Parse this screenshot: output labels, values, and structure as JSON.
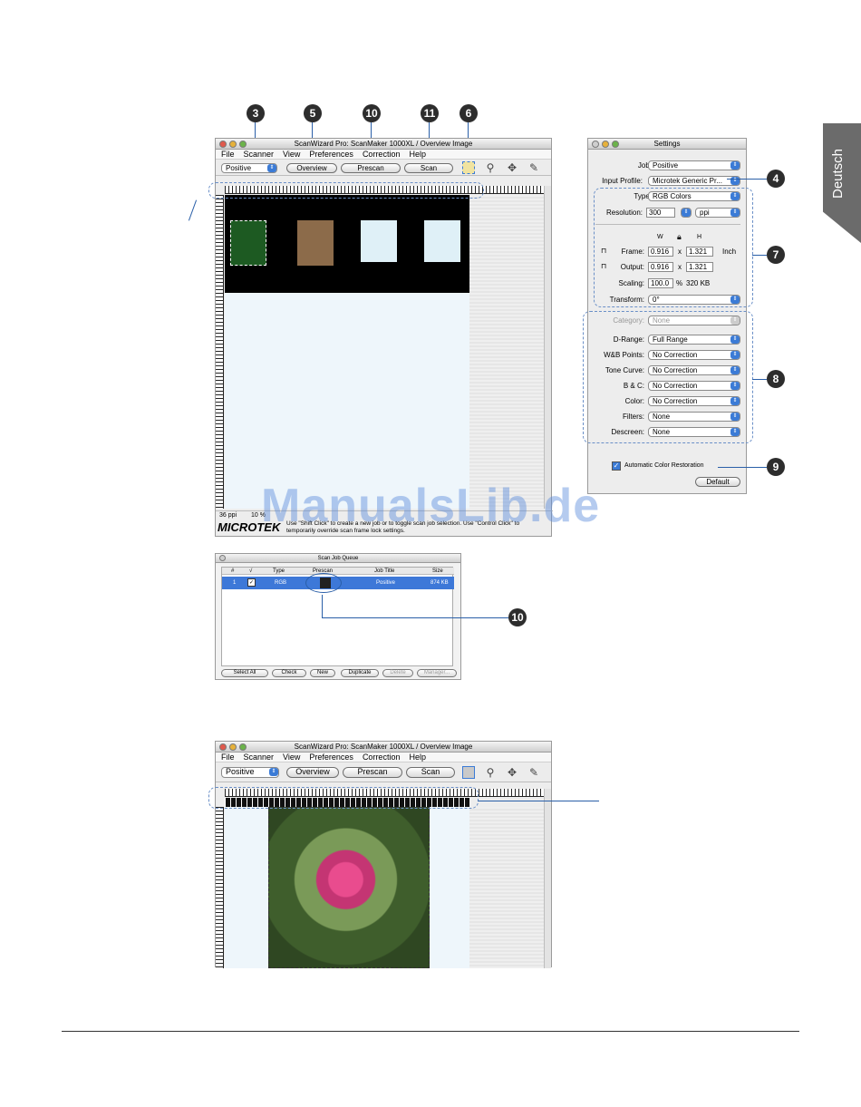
{
  "side_tab": "Deutsch",
  "callouts": [
    "3",
    "5",
    "10",
    "11",
    "6",
    "4",
    "7",
    "8",
    "9",
    "10"
  ],
  "main_window": {
    "title": "ScanWizard Pro: ScanMaker 1000XL / Overview Image",
    "menu": [
      "File",
      "Scanner",
      "View",
      "Preferences",
      "Correction",
      "Help"
    ],
    "job_popup": "Positive",
    "buttons": {
      "overview": "Overview",
      "prescan": "Prescan",
      "scan": "Scan"
    },
    "status_ppi": "36 ppi",
    "status_zoom": "10 %",
    "brand": "MICROTEK",
    "hint": "Use \"Shift Click\" to create a new job or to toggle scan job selection. Use \"Control Click\" to temporarily override scan frame lock settings."
  },
  "settings": {
    "title": "Settings",
    "job_label": "Job:",
    "job_value": "Positive",
    "input_profile_label": "Input Profile:",
    "input_profile_value": "Microtek Generic Pr...",
    "type_label": "Type:",
    "type_value": "RGB Colors",
    "resolution_label": "Resolution:",
    "resolution_value": "300",
    "resolution_unit": "ppi",
    "w_label": "W",
    "h_label": "H",
    "frame_label": "Frame:",
    "frame_w": "0.916",
    "frame_h": "1.321",
    "frame_unit": "Inch",
    "output_label": "Output:",
    "output_w": "0.916",
    "output_h": "1.321",
    "scaling_label": "Scaling:",
    "scaling_value": "100.0",
    "scaling_unit": "%",
    "file_size": "320 KB",
    "transform_label": "Transform:",
    "transform_value": "0°",
    "x_sep": "x",
    "category_label": "Category:",
    "category_value": "None",
    "drange_label": "D-Range:",
    "drange_value": "Full Range",
    "wb_label": "W&B Points:",
    "wb_value": "No Correction",
    "tone_label": "Tone Curve:",
    "tone_value": "No Correction",
    "bc_label": "B & C:",
    "bc_value": "No Correction",
    "color_label": "Color:",
    "color_value": "No Correction",
    "filters_label": "Filters:",
    "filters_value": "None",
    "descreen_label": "Descreen:",
    "descreen_value": "None",
    "acr_label": "Automatic Color Restoration",
    "default_button": "Default"
  },
  "queue": {
    "title": "Scan Job Queue",
    "headers": [
      "#",
      "√",
      "Type",
      "Prescan",
      "Job Title",
      "Size"
    ],
    "row": {
      "num": "1",
      "type": "RGB",
      "title": "Positive",
      "size": "874 KB"
    },
    "buttons": [
      "Select All",
      "Check",
      "New",
      "Duplicate",
      "Delete",
      "Manager..."
    ]
  },
  "second_window": {
    "title": "ScanWizard Pro: ScanMaker 1000XL / Overview Image",
    "menu": [
      "File",
      "Scanner",
      "View",
      "Preferences",
      "Correction",
      "Help"
    ],
    "job_popup": "Positive",
    "buttons": {
      "overview": "Overview",
      "prescan": "Prescan",
      "scan": "Scan"
    }
  },
  "watermark": "ManualsLib.de",
  "colors": {
    "accent_blue": "#3b7bd6",
    "callout": "#2d2d2d",
    "leader": "#2a5fa8",
    "side_tab": "#6b6b6b"
  }
}
